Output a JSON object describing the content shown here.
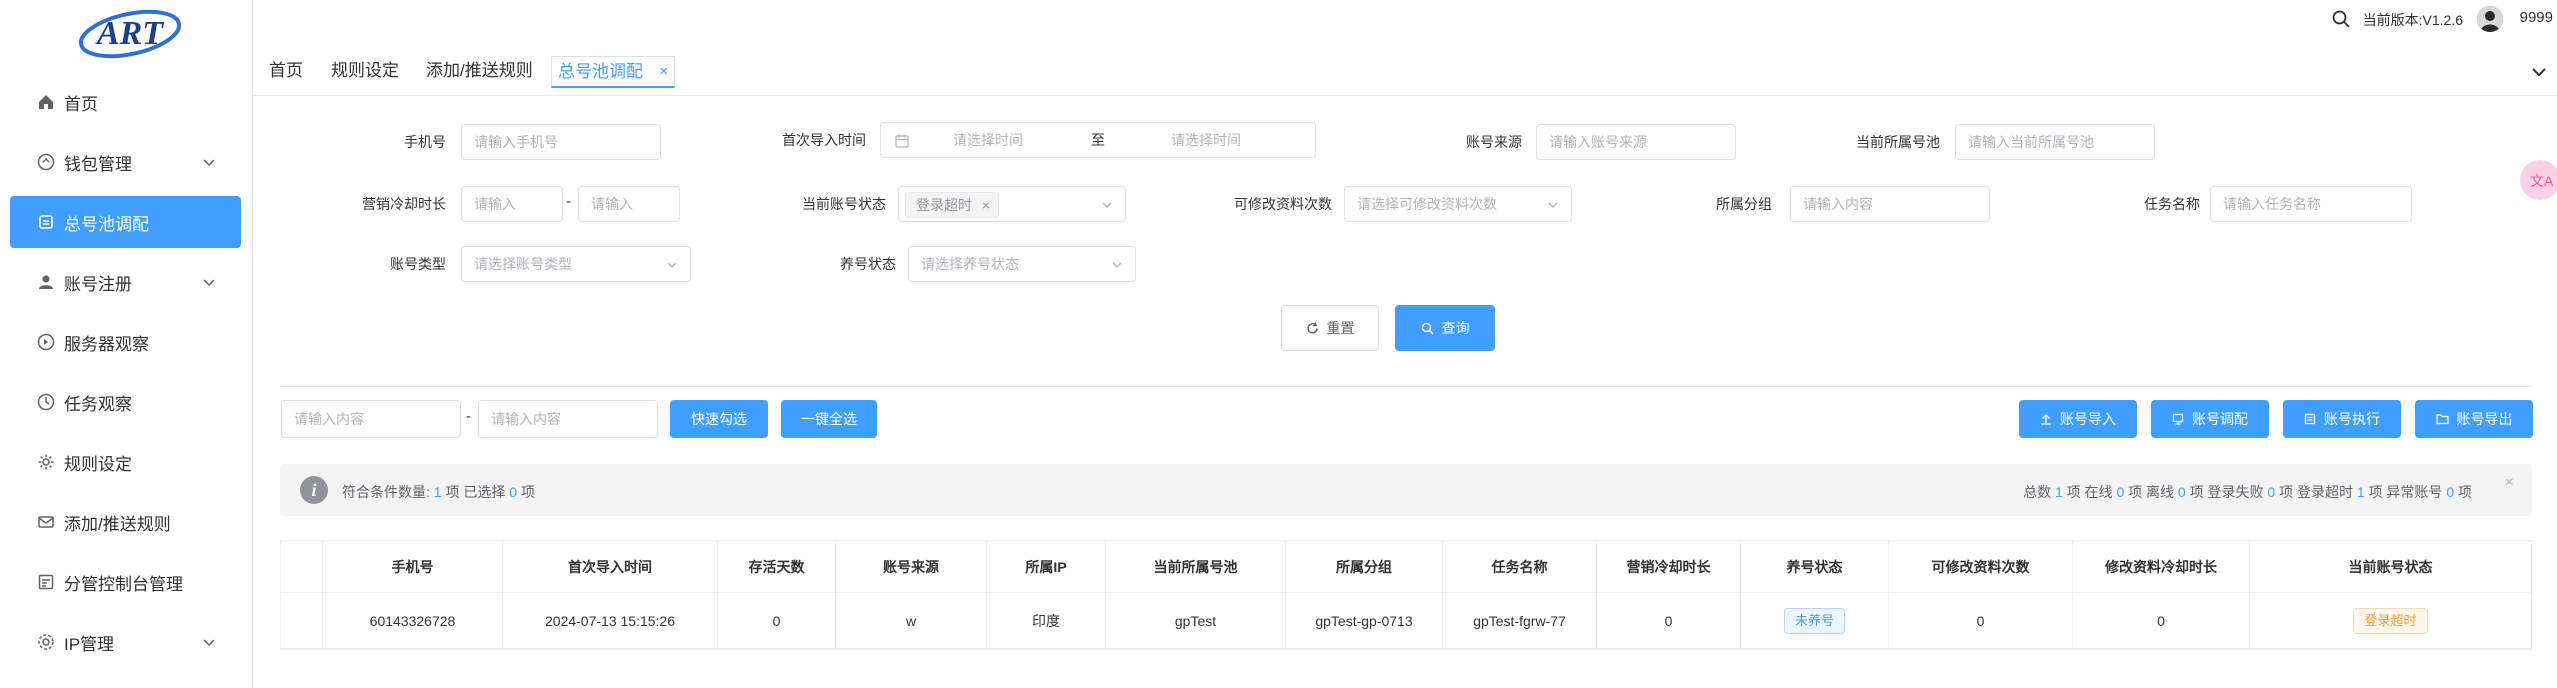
{
  "sidebar": {
    "logo_text": "ART",
    "items": [
      {
        "label": "首页",
        "icon": "home-icon"
      },
      {
        "label": "钱包管理",
        "icon": "wallet-icon"
      },
      {
        "label": "总号池调配",
        "icon": "pool-icon"
      },
      {
        "label": "账号注册",
        "icon": "user-icon"
      },
      {
        "label": "服务器观察",
        "icon": "server-icon"
      },
      {
        "label": "任务观察",
        "icon": "task-icon"
      },
      {
        "label": "规则设定",
        "icon": "gear-icon"
      },
      {
        "label": "添加/推送规则",
        "icon": "mail-icon"
      },
      {
        "label": "分管控制台管理",
        "icon": "console-icon"
      },
      {
        "label": "IP管理",
        "icon": "ip-icon"
      }
    ]
  },
  "header": {
    "version": "当前版本:V1.2.6",
    "username": "9999"
  },
  "tabs": [
    "首页",
    "规则设定",
    "添加/推送规则",
    "总号池调配"
  ],
  "active_tab_close": "×",
  "form": {
    "phone": {
      "label": "手机号",
      "placeholder": "请输入手机号"
    },
    "first_import": {
      "label": "首次导入时间",
      "start": "请选择时间",
      "sep": "至",
      "end": "请选择时间"
    },
    "source": {
      "label": "账号来源",
      "placeholder": "请输入账号来源"
    },
    "pool": {
      "label": "当前所属号池",
      "placeholder": "请输入当前所属号池"
    },
    "cooldown": {
      "label": "营销冷却时长",
      "p1": "请输入",
      "sep": "-",
      "p2": "请输入"
    },
    "status": {
      "label": "当前账号状态",
      "tag": "登录超时",
      "tag_close": "×"
    },
    "edit_count": {
      "label": "可修改资料次数",
      "placeholder": "请选择可修改资料次数"
    },
    "group": {
      "label": "所属分组",
      "placeholder": "请输入内容"
    },
    "task": {
      "label": "任务名称",
      "placeholder": "请输入任务名称"
    },
    "acc_type": {
      "label": "账号类型",
      "placeholder": "请选择账号类型"
    },
    "nurture": {
      "label": "养号状态",
      "placeholder": "请选择养号状态"
    },
    "reset": "重置",
    "query": "查询"
  },
  "toolbar": {
    "range_p1": "请输入内容",
    "range_sep": "-",
    "range_p2": "请输入内容",
    "quick_select": "快速勾选",
    "select_all": "一键全选",
    "import": "账号导入",
    "allocate": "账号调配",
    "execute": "账号执行",
    "export": "账号导出"
  },
  "info": {
    "left_prefix": "符合条件数量:",
    "match_count": "1",
    "left_mid": "项 已选择",
    "selected_count": "0",
    "left_suffix": "项",
    "total_label": "总数",
    "total": "1",
    "online_label": "项 在线",
    "online": "0",
    "offline_label": "项 离线",
    "offline": "0",
    "fail_label": "项 登录失败",
    "fail": "0",
    "timeout_label": "项 登录超时",
    "timeout": "1",
    "abnormal_label": "项 异常账号",
    "abnormal": "0",
    "end": "项",
    "close": "×"
  },
  "table": {
    "columns": [
      "",
      "手机号",
      "首次导入时间",
      "存活天数",
      "账号来源",
      "所属IP",
      "当前所属号池",
      "所属分组",
      "任务名称",
      "营销冷却时长",
      "养号状态",
      "可修改资料次数",
      "修改资料冷却时长",
      "当前账号状态"
    ],
    "rows": [
      [
        "",
        "60143326728",
        "2024-07-13 15:15:26",
        "0",
        "w",
        "印度",
        "gpTest",
        "gpTest-gp-0713",
        "gpTest-fgrw-77",
        "0",
        "未养号",
        "0",
        "0",
        "登录超时"
      ]
    ]
  },
  "colors": {
    "accent": "#409eff",
    "warning": "#e6a23c"
  }
}
